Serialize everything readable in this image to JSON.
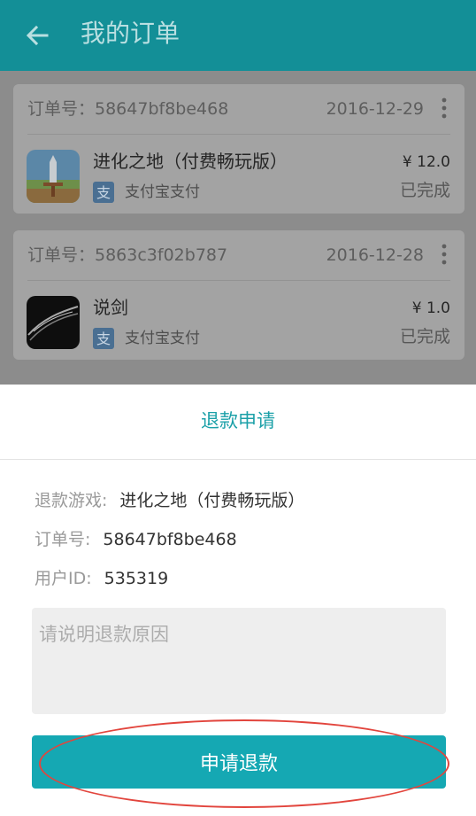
{
  "header": {
    "title": "我的订单",
    "back_icon": "arrow-left-icon"
  },
  "orders": [
    {
      "order_no": "订单号：58647bf8be468",
      "date": "2016-12-29",
      "game": "进化之地（付费畅玩版）",
      "pay_method": "支付宝支付",
      "price": "¥ 12.0",
      "status": "已完成",
      "pay_icon_glyph": "支"
    },
    {
      "order_no": "订单号：5863c3f02b787",
      "date": "2016-12-28",
      "game": "说剑",
      "pay_method": "支付宝支付",
      "price": "¥ 1.0",
      "status": "已完成",
      "pay_icon_glyph": "支"
    }
  ],
  "refund": {
    "title": "退款申请",
    "game_label": "退款游戏:",
    "game_value": "进化之地（付费畅玩版）",
    "order_label": "订单号:",
    "order_value": "58647bf8be468",
    "user_label": "用户ID:",
    "user_value": "535319",
    "reason_placeholder": "请说明退款原因",
    "reason_value": "",
    "submit_label": "申请退款"
  },
  "colors": {
    "accent": "#15a8b3",
    "header": "#138f97",
    "highlight": "#e2453d",
    "alipay": "#1e7bd6"
  }
}
